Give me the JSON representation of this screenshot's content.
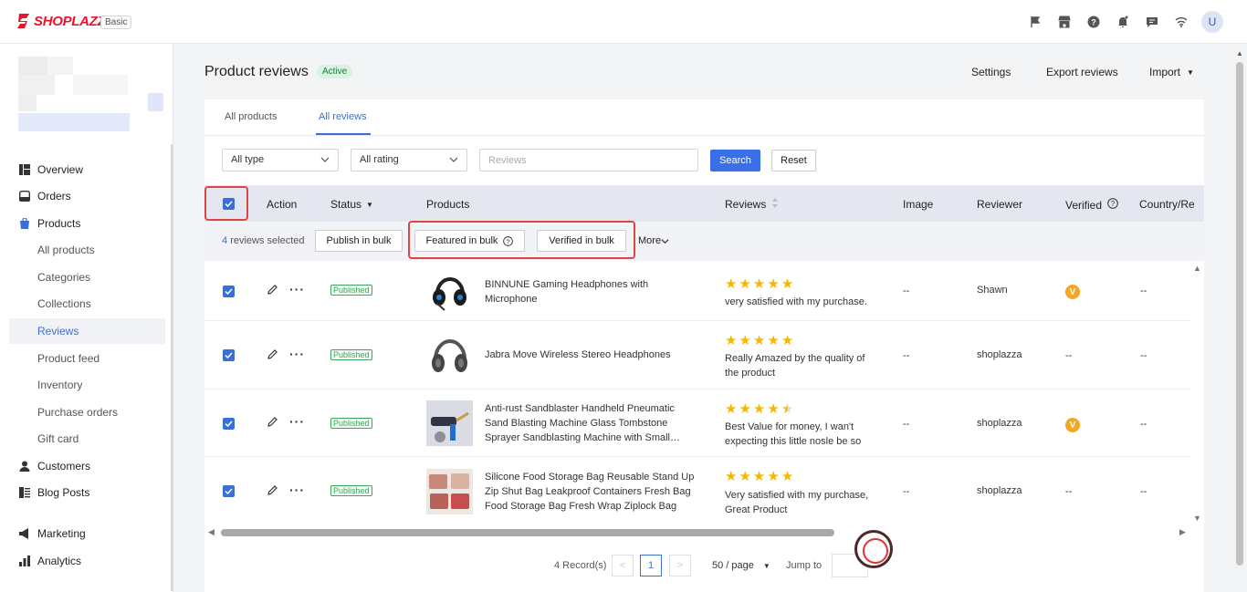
{
  "brand": {
    "name": "SHOPLAZZA",
    "plan": "Basic",
    "color": "#e6162d"
  },
  "topbar": {
    "icons": [
      "flag-icon",
      "store-icon",
      "help-icon",
      "bell-icon",
      "chat-icon",
      "wifi-icon"
    ],
    "avatar_letter": "U"
  },
  "sidebar": {
    "items": [
      {
        "label": "Overview",
        "icon": "overview-icon"
      },
      {
        "label": "Orders",
        "icon": "orders-icon"
      },
      {
        "label": "Products",
        "icon": "products-icon"
      },
      {
        "label": "All products"
      },
      {
        "label": "Categories"
      },
      {
        "label": "Collections"
      },
      {
        "label": "Reviews",
        "active": true
      },
      {
        "label": "Product feed"
      },
      {
        "label": "Inventory"
      },
      {
        "label": "Purchase orders"
      },
      {
        "label": "Gift card"
      },
      {
        "label": "Customers",
        "icon": "customers-icon"
      },
      {
        "label": "Blog Posts",
        "icon": "blog-icon"
      },
      {
        "label": "Marketing",
        "icon": "marketing-icon"
      },
      {
        "label": "Analytics",
        "icon": "analytics-icon"
      }
    ]
  },
  "page": {
    "title": "Product reviews",
    "status_badge": "Active",
    "actions": {
      "settings": "Settings",
      "export": "Export reviews",
      "import": "Import"
    }
  },
  "tabs": [
    {
      "label": "All products"
    },
    {
      "label": "All reviews",
      "active": true
    }
  ],
  "filters": {
    "type": "All type",
    "rating": "All rating",
    "search_placeholder": "Reviews",
    "search_label": "Search",
    "reset_label": "Reset"
  },
  "table": {
    "headers": {
      "action": "Action",
      "status": "Status",
      "products": "Products",
      "reviews": "Reviews",
      "image": "Image",
      "reviewer": "Reviewer",
      "verified": "Verified",
      "country": "Country/Re"
    },
    "bulk": {
      "count": "4",
      "selected_text": "reviews selected",
      "publish": "Publish in bulk",
      "featured": "Featured in bulk",
      "verified": "Verified in bulk",
      "more": "More"
    },
    "rows": [
      {
        "status": "Published",
        "product": "BINNUNE Gaming Headphones with Microphone",
        "rating": 5,
        "review": "very satisfied with my purchase.",
        "image": "--",
        "reviewer": "Shawn",
        "verified": true,
        "verified_mark": "V",
        "country": "--"
      },
      {
        "status": "Published",
        "product": "Jabra Move Wireless Stereo Headphones",
        "rating": 5,
        "review": "Really Amazed by the quality of the product",
        "image": "--",
        "reviewer": "shoplazza",
        "verified": false,
        "verified_text": "--",
        "country": "--"
      },
      {
        "status": "Published",
        "product": "Anti-rust Sandblaster Handheld Pneumatic Sand Blasting Machine Glass Tombstone Sprayer Sandblasting Machine with Small…",
        "rating": 4.5,
        "review": "Best Value for money, I wan't expecting this little nosle be so s…",
        "image": "--",
        "reviewer": "shoplazza",
        "verified": true,
        "verified_mark": "V",
        "country": "--"
      },
      {
        "status": "Published",
        "product": "Silicone Food Storage Bag Reusable Stand Up Zip Shut Bag Leakproof Containers Fresh Bag Food Storage Bag Fresh Wrap Ziplock Bag",
        "rating": 5,
        "review": "Very satisfied with my purchase, Great Product",
        "image": "--",
        "reviewer": "shoplazza",
        "verified": false,
        "verified_text": "--",
        "country": "--"
      }
    ]
  },
  "pagination": {
    "records": "4 Record(s)",
    "current_page": "1",
    "per_page": "50 / page",
    "jump_label": "Jump to"
  },
  "colors": {
    "accent": "#3b6fd8",
    "primary_button": "#3b6fe8",
    "star": "#f5b800",
    "published": "#3fa55a",
    "highlight": "#e04545"
  }
}
